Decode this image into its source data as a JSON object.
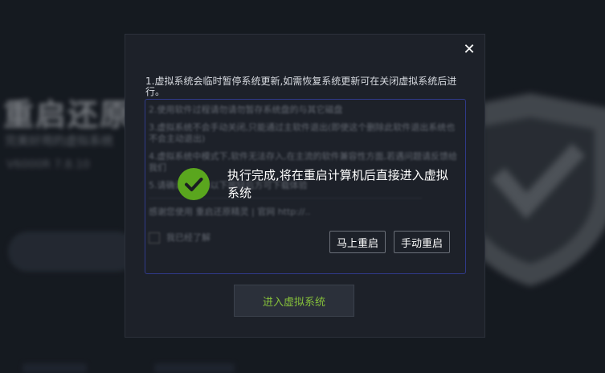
{
  "background": {
    "title": "重启还原",
    "subtitle": "完美好用的虚拟系统",
    "meta": "V6000R  7.8.10"
  },
  "dialog": {
    "close_icon": "close-icon",
    "notice": "1.虚拟系统会临时暂停系统更新,如需恢复系统更新可在关闭虚拟系统后进行。",
    "terms": [
      "2.使用软件过程请勿请勿暂存系统盘的与其它磁盘",
      "3.虚拟系统不会手动关闭,只能通过主软件退出(即使这个删除此软件退出系统也不会主动退出)",
      "4.虚拟系统中模式下,软件无法存入,在主流的软件兼容性方面,若遇问题请反馈给我们",
      "5.请确认后点击以下按钮后方可下载体验"
    ],
    "terms_footer": "感谢您使用 重启还原精灵 | 官网 http://..",
    "agree_label": "我已经了解",
    "enter_button": "进入虚拟系统"
  },
  "popup": {
    "icon": "check-circle-icon",
    "message": "执行完成,将在重启计算机后直接进入虚拟系统",
    "restart_now": "马上重启",
    "manual_restart": "手动重启"
  },
  "colors": {
    "accent_green": "#86c13a",
    "check_green": "#5aa61e",
    "border_blue": "#303a8a"
  }
}
